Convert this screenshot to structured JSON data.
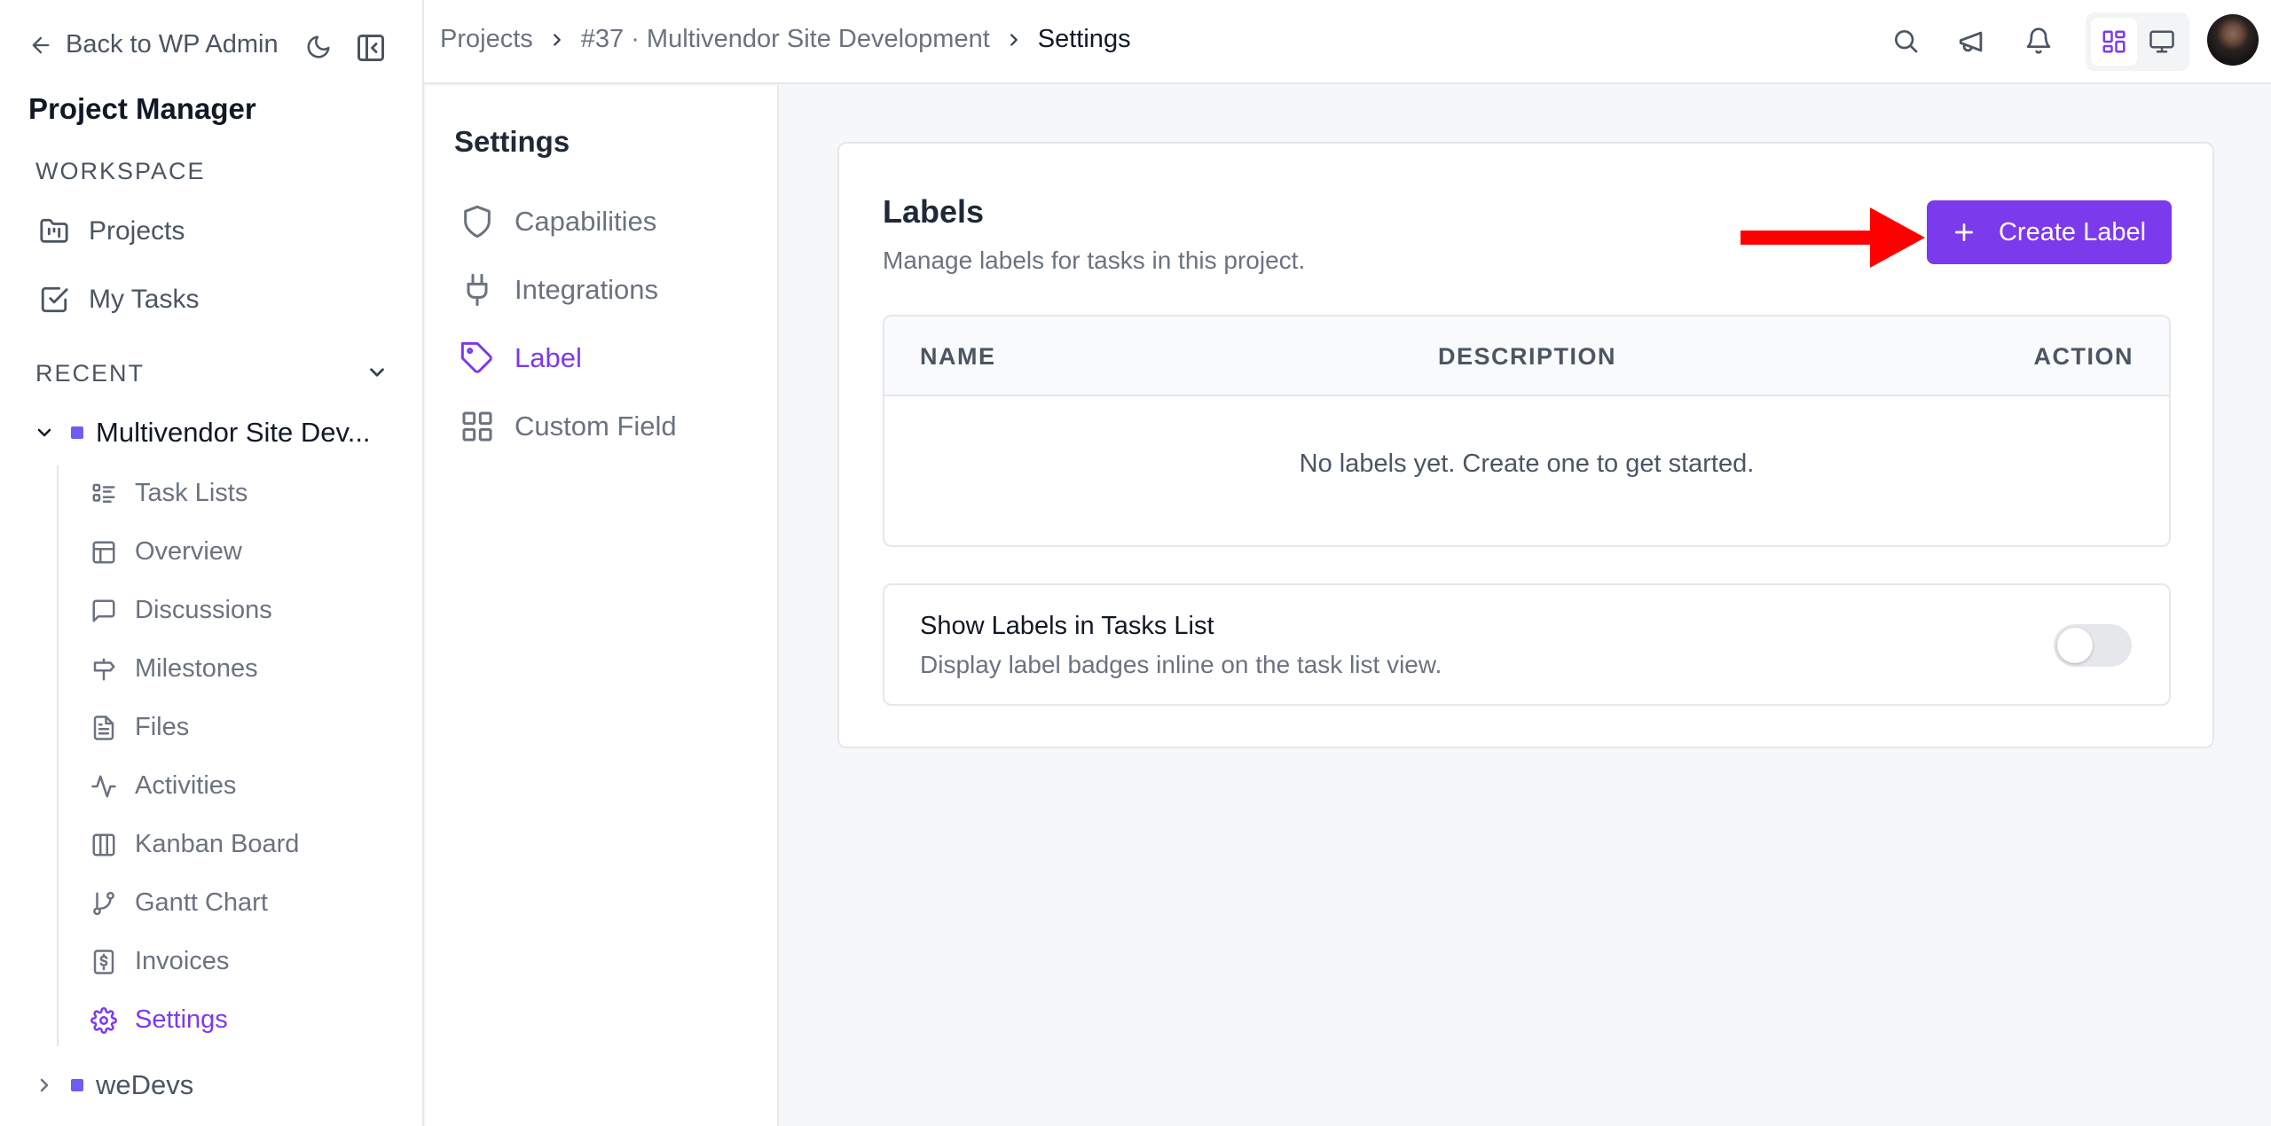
{
  "sidebar": {
    "back_label": "Back to WP Admin",
    "app_title": "Project Manager",
    "workspace_label": "WORKSPACE",
    "workspace_items": [
      {
        "label": "Projects",
        "icon": "folder-kanban-icon"
      },
      {
        "label": "My Tasks",
        "icon": "check-square-icon"
      }
    ],
    "recent_label": "RECENT",
    "recent_projects": [
      {
        "label": "Multivendor Site Dev...",
        "expanded": true
      },
      {
        "label": "weDevs",
        "expanded": false
      }
    ],
    "project_items": [
      {
        "label": "Task Lists",
        "icon": "list-icon"
      },
      {
        "label": "Overview",
        "icon": "layout-icon"
      },
      {
        "label": "Discussions",
        "icon": "message-icon"
      },
      {
        "label": "Milestones",
        "icon": "signpost-icon"
      },
      {
        "label": "Files",
        "icon": "file-icon"
      },
      {
        "label": "Activities",
        "icon": "activity-icon"
      },
      {
        "label": "Kanban Board",
        "icon": "columns-icon"
      },
      {
        "label": "Gantt Chart",
        "icon": "git-branch-icon"
      },
      {
        "label": "Invoices",
        "icon": "receipt-icon"
      },
      {
        "label": "Settings",
        "icon": "gear-icon",
        "active": true
      }
    ],
    "accent_color": "#7c3aed"
  },
  "breadcrumb": {
    "items": [
      "Projects",
      "#37 · Multivendor Site Development",
      "Settings"
    ]
  },
  "settings_nav": {
    "title": "Settings",
    "items": [
      {
        "label": "Capabilities",
        "icon": "shield-icon"
      },
      {
        "label": "Integrations",
        "icon": "plug-icon"
      },
      {
        "label": "Label",
        "icon": "tag-icon",
        "active": true
      },
      {
        "label": "Custom Field",
        "icon": "grid-icon"
      }
    ]
  },
  "labels_panel": {
    "title": "Labels",
    "subtitle": "Manage labels for tasks in this project.",
    "create_button": "Create Label",
    "table": {
      "columns": [
        "NAME",
        "DESCRIPTION",
        "ACTION"
      ],
      "rows": [],
      "empty_text": "No labels yet. Create one to get started."
    },
    "show_labels": {
      "title": "Show Labels in Tasks List",
      "description": "Display label badges inline on the task list view.",
      "enabled": false
    }
  },
  "annotation": {
    "arrow_color": "#ff0000"
  }
}
